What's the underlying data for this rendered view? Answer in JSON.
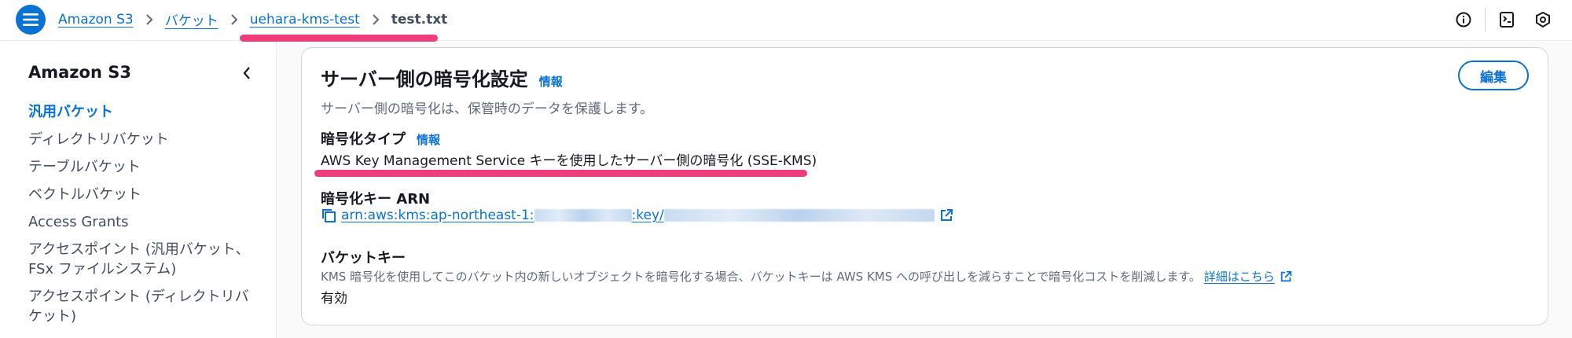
{
  "breadcrumb": {
    "items": [
      "Amazon S3",
      "バケット",
      "uehara-kms-test"
    ],
    "current": "test.txt"
  },
  "sidebar": {
    "title": "Amazon S3",
    "items": [
      {
        "label": "汎用バケット",
        "active": true
      },
      {
        "label": "ディレクトリバケット"
      },
      {
        "label": "テーブルバケット"
      },
      {
        "label": "ベクトルバケット"
      },
      {
        "label": "Access Grants"
      },
      {
        "label": "アクセスポイント (汎用バケット、 FSx ファイルシステム)"
      },
      {
        "label": "アクセスポイント (ディレクトリバケット)"
      }
    ]
  },
  "encryption": {
    "title": "サーバー側の暗号化設定",
    "info_label": "情報",
    "description": "サーバー側の暗号化は、保管時のデータを保護します。",
    "edit_label": "編集",
    "type_label": "暗号化タイプ",
    "type_info_label": "情報",
    "type_value": "AWS Key Management Service キーを使用したサーバー側の暗号化 (SSE-KMS)",
    "arn_label": "暗号化キー ARN",
    "arn_prefix": "arn:aws:kms:ap-northeast-1:",
    "arn_middle": ":key/",
    "bucket_key_label": "バケットキー",
    "bucket_key_desc": "KMS 暗号化を使用してこのバケット内の新しいオブジェクトを暗号化する場合、バケットキーは AWS KMS への呼び出しを減らすことで暗号化コストを削減します。",
    "bucket_key_link": "詳細はこちら",
    "bucket_key_value": "有効"
  },
  "colors": {
    "accent": "#0972d3",
    "highlight": "#f03c7a"
  }
}
